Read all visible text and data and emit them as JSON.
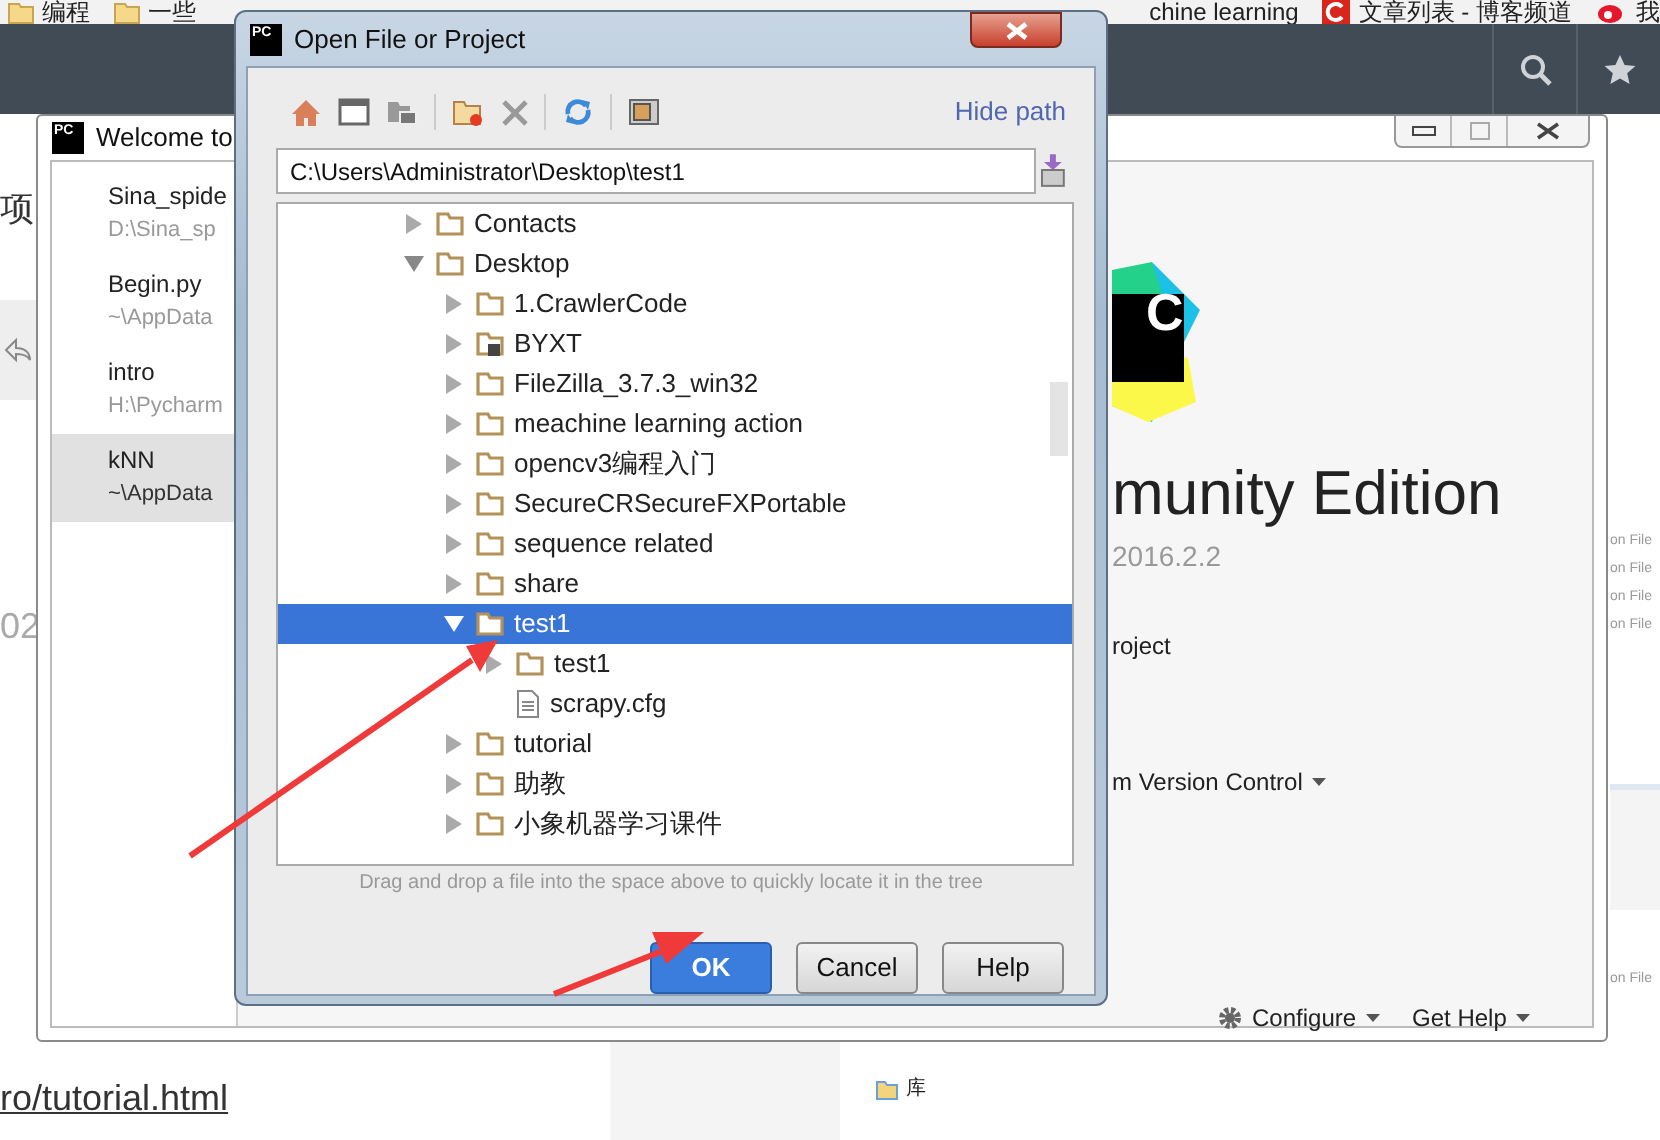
{
  "browser": {
    "bookmarks": [
      {
        "label": "编程",
        "kind": "folder"
      },
      {
        "label": "一些",
        "kind": "folder"
      },
      {
        "label": "chine learning",
        "kind": "plain"
      },
      {
        "label": "文章列表 - 博客频道",
        "kind": "site"
      },
      {
        "label": "我",
        "kind": "weibo"
      }
    ]
  },
  "background_page": {
    "heading_fragment": "项",
    "number_fragment": "02",
    "link": "ro/tutorial.html",
    "side_items": [
      "on File",
      "on File",
      "on File",
      "on File"
    ],
    "side_item_bottom": "on File",
    "explorer_item": "库"
  },
  "welcome_window": {
    "icon_text": "PC",
    "title": "Welcome to",
    "recent_projects": [
      {
        "name": "Sina_spide",
        "path": "D:\\Sina_sp",
        "selected": false
      },
      {
        "name": "Begin.py",
        "path": "~\\AppData",
        "selected": false
      },
      {
        "name": "intro",
        "path": "H:\\Pycharm",
        "selected": false
      },
      {
        "name": "kNN",
        "path": "~\\AppData",
        "selected": true
      }
    ],
    "logo_text": "C",
    "product_name": "munity Edition",
    "version": "2016.2.2",
    "actions": [
      {
        "label": "roject",
        "dropdown": false
      },
      {
        "label": "m Version Control",
        "dropdown": true
      }
    ],
    "footer_links": [
      {
        "label": "Configure",
        "kind": "gear"
      },
      {
        "label": "Get Help",
        "kind": "plain"
      }
    ]
  },
  "dialog": {
    "icon_text": "PC",
    "title": "Open File or Project",
    "hide_path": "Hide path",
    "path": "C:\\Users\\Administrator\\Desktop\\test1",
    "tree": [
      {
        "label": "Contacts",
        "kind": "folder",
        "expanded": false,
        "selected": false
      },
      {
        "label": "Desktop",
        "kind": "folder",
        "expanded": true,
        "selected": false,
        "children": [
          {
            "label": "1.CrawlerCode",
            "kind": "folder",
            "expanded": false,
            "selected": false
          },
          {
            "label": "BYXT",
            "kind": "module",
            "expanded": false,
            "selected": false
          },
          {
            "label": "FileZilla_3.7.3_win32",
            "kind": "folder",
            "expanded": false,
            "selected": false
          },
          {
            "label": "meachine learning action",
            "kind": "folder",
            "expanded": false,
            "selected": false
          },
          {
            "label": "opencv3编程入门",
            "kind": "folder",
            "expanded": false,
            "selected": false
          },
          {
            "label": "SecureCRSecureFXPortable",
            "kind": "folder",
            "expanded": false,
            "selected": false
          },
          {
            "label": "sequence related",
            "kind": "folder",
            "expanded": false,
            "selected": false
          },
          {
            "label": "share",
            "kind": "folder",
            "expanded": false,
            "selected": false
          },
          {
            "label": "test1",
            "kind": "folder",
            "expanded": true,
            "selected": true,
            "children": [
              {
                "label": "test1",
                "kind": "folder",
                "expanded": false,
                "selected": false
              },
              {
                "label": "scrapy.cfg",
                "kind": "file",
                "selected": false
              }
            ]
          },
          {
            "label": "tutorial",
            "kind": "folder",
            "expanded": false,
            "selected": false
          },
          {
            "label": "助教",
            "kind": "folder",
            "expanded": false,
            "selected": false
          },
          {
            "label": "小象机器学习课件",
            "kind": "folder",
            "expanded": false,
            "selected": false
          }
        ]
      }
    ],
    "hint": "Drag and drop a file into the space above to quickly locate it in the tree",
    "buttons": [
      {
        "label": "OK",
        "kind": "default"
      },
      {
        "label": "Cancel",
        "kind": "normal"
      },
      {
        "label": "Help",
        "kind": "normal"
      }
    ]
  }
}
